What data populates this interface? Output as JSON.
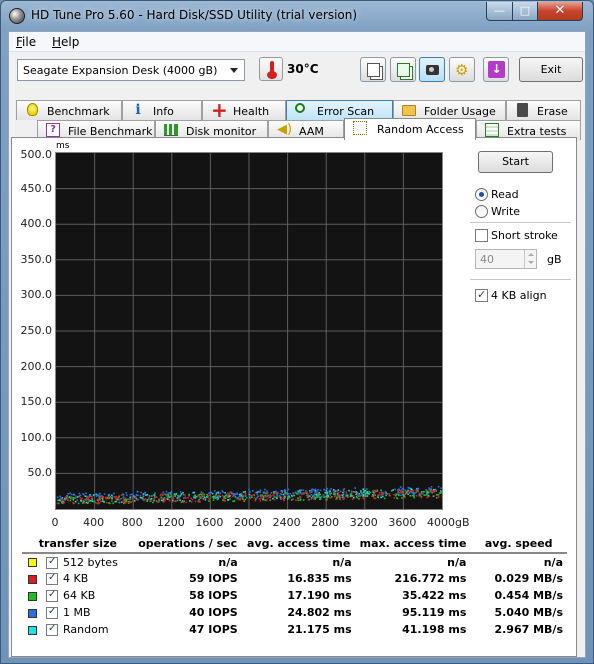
{
  "window": {
    "title": "HD Tune Pro 5.60 - Hard Disk/SSD Utility (trial version)",
    "minimize_glyph": "—",
    "maximize_glyph": "□",
    "close_glyph": "✕"
  },
  "menu": {
    "file": "File",
    "help": "Help"
  },
  "toolbar": {
    "drive": "Seagate Expansion Desk (4000 gB)",
    "temperature": "30°C",
    "exit_label": "Exit",
    "buttons": [
      "copy-text-icon",
      "copy-screenshot-icon",
      "camera-icon",
      "options-icon",
      "save-icon"
    ]
  },
  "tabs_row1": [
    {
      "label": "Benchmark",
      "icon": "bulb-icon"
    },
    {
      "label": "Info",
      "icon": "info-icon"
    },
    {
      "label": "Health",
      "icon": "health-icon"
    },
    {
      "label": "Error Scan",
      "icon": "search-icon"
    },
    {
      "label": "Folder Usage",
      "icon": "folder-icon"
    },
    {
      "label": "Erase",
      "icon": "trash-icon"
    }
  ],
  "tabs_row2": [
    {
      "label": "File Benchmark",
      "icon": "file-benchmark-icon"
    },
    {
      "label": "Disk monitor",
      "icon": "disk-monitor-icon"
    },
    {
      "label": "AAM",
      "icon": "speaker-icon"
    },
    {
      "label": "Random Access",
      "icon": "random-access-icon",
      "active": true
    },
    {
      "label": "Extra tests",
      "icon": "extra-tests-icon"
    }
  ],
  "controls": {
    "start": "Start",
    "read": "Read",
    "write": "Write",
    "mode_selected": "Read",
    "short_stroke": "Short stroke",
    "short_stroke_checked": false,
    "short_stroke_value": "40",
    "short_stroke_unit": "gB",
    "align": "4 KB align",
    "align_checked": true
  },
  "chart_data": {
    "type": "scatter",
    "ylabel": "ms",
    "xlabel_unit": "gB",
    "ylim": [
      0,
      500
    ],
    "xlim": [
      0,
      4000
    ],
    "y_ticks": [
      "500.0",
      "450.0",
      "400.0",
      "350.0",
      "300.0",
      "250.0",
      "200.0",
      "150.0",
      "100.0",
      "50.0"
    ],
    "x_ticks": [
      "0",
      "400",
      "800",
      "1200",
      "1600",
      "2000",
      "2400",
      "2800",
      "3200",
      "3600",
      "4000gB"
    ],
    "grid": true,
    "series": [
      {
        "name": "512 bytes",
        "color": "#e8e800",
        "points": "not measured"
      },
      {
        "name": "4 KB",
        "color": "#d42020",
        "approx_access_ms": {
          "min": 9,
          "max": 30,
          "trend_from_gB_0_to_4000": [
            13,
            23
          ]
        }
      },
      {
        "name": "64 KB",
        "color": "#20c020",
        "approx_access_ms": {
          "min": 9,
          "max": 30,
          "trend_from_gB_0_to_4000": [
            13,
            23
          ]
        }
      },
      {
        "name": "1 MB",
        "color": "#2a6fdc",
        "approx_access_ms": {
          "min": 14,
          "max": 36,
          "trend_from_gB_0_to_4000": [
            18,
            27
          ]
        }
      },
      {
        "name": "Random",
        "color": "#20d8e8",
        "approx_access_ms": {
          "min": 10,
          "max": 32,
          "trend_from_gB_0_to_4000": [
            15,
            25
          ]
        }
      }
    ]
  },
  "results": {
    "headers": [
      "transfer size",
      "operations / sec",
      "avg. access time",
      "max. access time",
      "avg. speed"
    ],
    "rows": [
      {
        "size": "512 bytes",
        "color": "#ffff00",
        "ops": "n/a",
        "avg": "n/a",
        "max": "n/a",
        "speed": "n/a"
      },
      {
        "size": "4 KB",
        "color": "#d42020",
        "ops": "59 IOPS",
        "avg": "16.835 ms",
        "max": "216.772 ms",
        "speed": "0.029 MB/s"
      },
      {
        "size": "64 KB",
        "color": "#20c020",
        "ops": "58 IOPS",
        "avg": "17.190 ms",
        "max": "35.422 ms",
        "speed": "0.454 MB/s"
      },
      {
        "size": "1 MB",
        "color": "#2a6fdc",
        "ops": "40 IOPS",
        "avg": "24.802 ms",
        "max": "95.119 ms",
        "speed": "5.040 MB/s"
      },
      {
        "size": "Random",
        "color": "#20e0e0",
        "ops": "47 IOPS",
        "avg": "21.175 ms",
        "max": "41.198 ms",
        "speed": "2.967 MB/s"
      }
    ]
  }
}
